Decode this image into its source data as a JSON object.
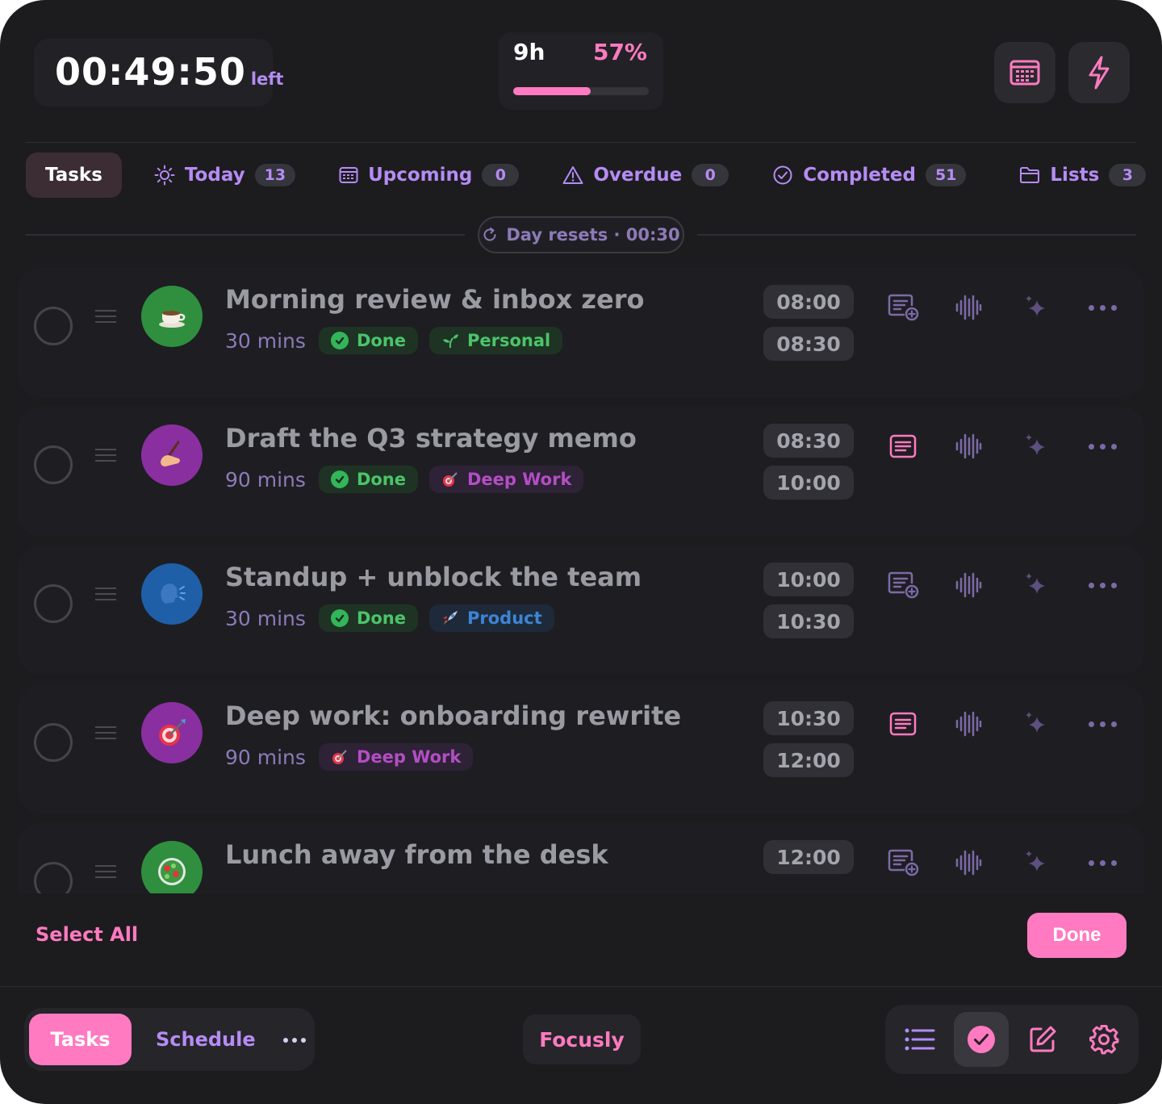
{
  "header": {
    "timer_value": "00:49:50",
    "timer_suffix": "left",
    "progress_hours": "9h",
    "progress_percent_label": "57%",
    "progress_fraction": 0.57,
    "calendar_icon": "calendar-icon",
    "bolt_icon": "bolt-icon"
  },
  "colors": {
    "accent_pink": "#ff7ac0",
    "accent_purple": "#b58cf3",
    "done_green": "#4bc46a",
    "deep_work_purple": "#b34ec4",
    "product_blue": "#3d84d6",
    "background": "#1c1c1f"
  },
  "tabs": {
    "active": "Tasks",
    "items": [
      {
        "label": "Today",
        "count": "13",
        "icon": "sun-icon"
      },
      {
        "label": "Upcoming",
        "count": "0",
        "icon": "calendar-icon"
      },
      {
        "label": "Overdue",
        "count": "0",
        "icon": "warning-icon"
      },
      {
        "label": "Completed",
        "count": "51",
        "icon": "check-circle-icon"
      },
      {
        "label": "Lists",
        "count": "3",
        "icon": "folder-icon"
      }
    ]
  },
  "day_reset": {
    "label": "Day resets · 00:30",
    "icon": "refresh-icon"
  },
  "tasks": [
    {
      "title": "Morning review & inbox zero",
      "duration": "30 mins",
      "status": "Done",
      "list": "Personal",
      "list_color": "green",
      "start": "08:00",
      "end": "08:30",
      "avatar": "coffee-icon",
      "note_icon": "note-add-icon"
    },
    {
      "title": "Draft the Q3 strategy memo",
      "duration": "90 mins",
      "status": "Done",
      "list": "Deep Work",
      "list_color": "purple",
      "start": "08:30",
      "end": "10:00",
      "avatar": "writing-hand-icon",
      "note_icon": "note-icon"
    },
    {
      "title": "Standup + unblock the team",
      "duration": "30 mins",
      "status": "Done",
      "list": "Product",
      "list_color": "blue",
      "start": "10:00",
      "end": "10:30",
      "avatar": "speaking-head-icon",
      "note_icon": "note-add-icon"
    },
    {
      "title": "Deep work: onboarding rewrite",
      "duration": "90 mins",
      "status": "",
      "list": "Deep Work",
      "list_color": "purple",
      "start": "10:30",
      "end": "12:00",
      "avatar": "target-icon",
      "note_icon": "note-icon"
    },
    {
      "title": "Lunch away from the desk",
      "duration": "",
      "status": "",
      "list": "",
      "list_color": "green",
      "start": "12:00",
      "end": "",
      "avatar": "salad-icon",
      "note_icon": "note-add-icon"
    }
  ],
  "footer": {
    "select_all": "Select All",
    "done": "Done"
  },
  "bottom_bar": {
    "tasks": "Tasks",
    "schedule": "Schedule",
    "brand": "Focusly",
    "icons": [
      "list-icon",
      "check-circle-icon",
      "edit-icon",
      "settings-icon"
    ]
  }
}
